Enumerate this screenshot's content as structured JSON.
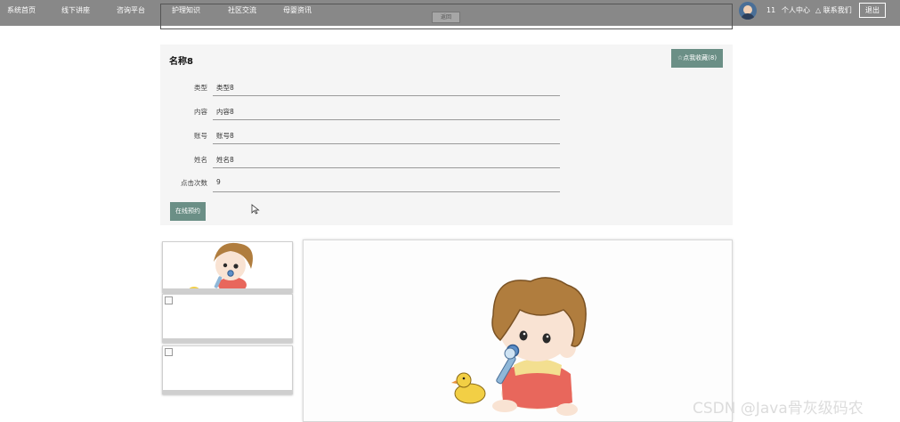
{
  "nav": {
    "items": [
      "系统首页",
      "线下讲座",
      "咨询平台",
      "护理知识",
      "社区交流",
      "母婴资讯"
    ],
    "back_label": "返回",
    "user_id": "11",
    "personal_center": "个人中心",
    "contact": "△ 联系我们",
    "logout": "退出"
  },
  "detail": {
    "title": "名称8",
    "favorite_button": "☆点我收藏(8)",
    "fields": [
      {
        "label": "类型",
        "value": "类型8"
      },
      {
        "label": "内容",
        "value": "内容8"
      },
      {
        "label": "账号",
        "value": "账号8"
      },
      {
        "label": "姓名",
        "value": "姓名8"
      },
      {
        "label": "点击次数",
        "value": "9"
      }
    ],
    "book_button": "在线预约"
  },
  "gallery": {
    "thumbnails": [
      "baby-illustration",
      "broken-image",
      "broken-image"
    ],
    "main": "baby-illustration"
  },
  "watermark": "CSDN @Java骨灰级码农",
  "colors": {
    "nav_bg": "#888888",
    "button": "#6b8f86",
    "panel": "#f5f5f5"
  }
}
